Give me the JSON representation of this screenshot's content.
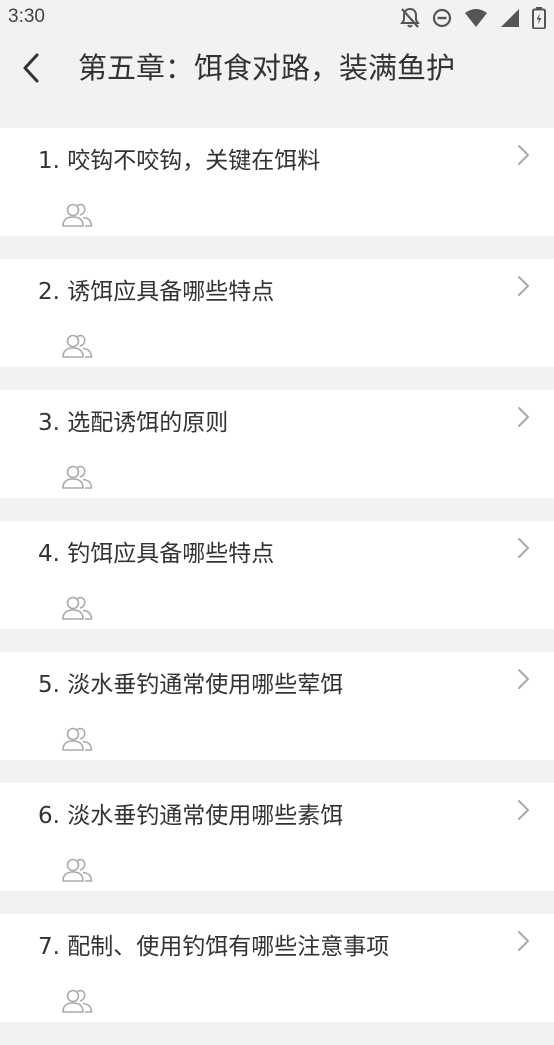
{
  "status_bar": {
    "time": "3:30",
    "icons": [
      "notifications-off-icon",
      "do-not-disturb-icon",
      "wifi-icon",
      "cellular-signal-icon",
      "battery-icon"
    ]
  },
  "header": {
    "title": "第五章：饵食对路，装满鱼护",
    "back_icon": "chevron-left-icon"
  },
  "list": {
    "items": [
      {
        "title": "1. 咬钩不咬钩，关键在饵料"
      },
      {
        "title": "2. 诱饵应具备哪些特点"
      },
      {
        "title": "3. 选配诱饵的原则"
      },
      {
        "title": "4. 钓饵应具备哪些特点"
      },
      {
        "title": "5. 淡水垂钓通常使用哪些荤饵"
      },
      {
        "title": "6. 淡水垂钓通常使用哪些素饵"
      },
      {
        "title": "7. 配制、使用钓饵有哪些注意事项"
      }
    ],
    "item_icon": "users-icon",
    "item_chevron": "chevron-right-icon"
  },
  "colors": {
    "background": "#f2f2f2",
    "card": "#ffffff",
    "text": "#333333",
    "icon_gray": "#aaaaaa"
  }
}
